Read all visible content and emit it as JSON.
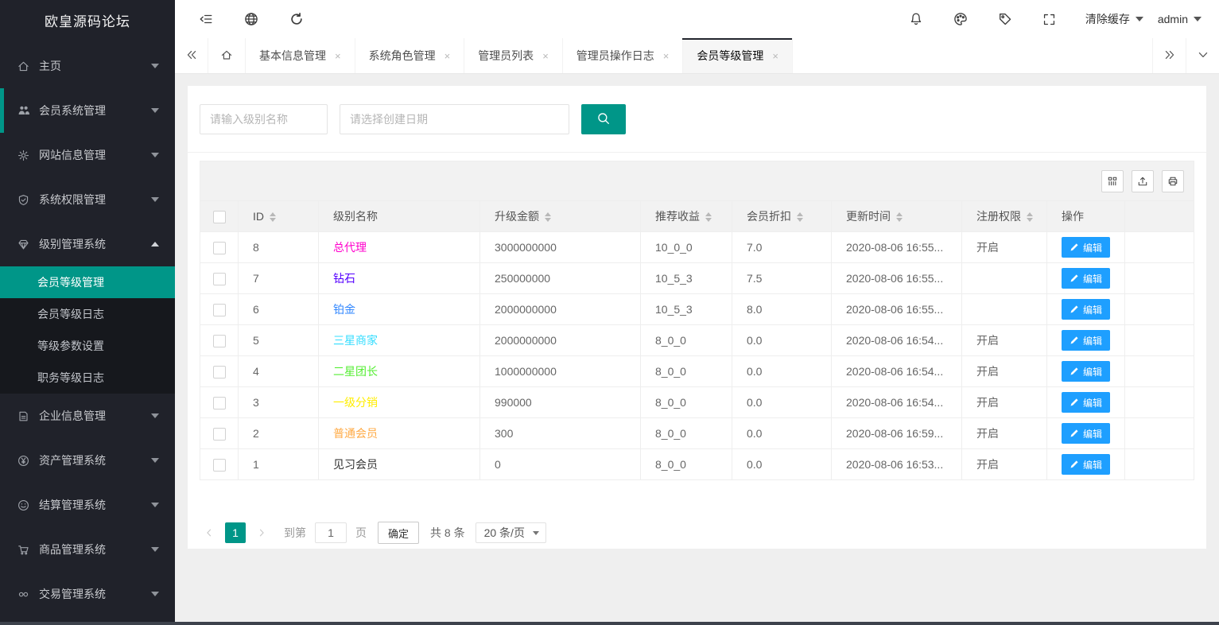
{
  "brand": "欧皇源码论坛",
  "colors": {
    "accent": "#009688",
    "primary_button": "#1e9fff",
    "sidebar_bg": "#20222a",
    "active_tab_bar": "#23262e"
  },
  "topbar": {
    "left_icons": [
      "collapse-menu-icon",
      "globe-icon",
      "refresh-icon"
    ],
    "right_icons": [
      "bell-icon",
      "palette-icon",
      "tag-icon",
      "fullscreen-icon"
    ],
    "clear_cache_label": "清除缓存",
    "username": "admin"
  },
  "sidebar": {
    "items": [
      {
        "label": "主页",
        "icon": "home-icon",
        "expanded": false
      },
      {
        "label": "会员系统管理",
        "icon": "users-icon",
        "expanded": false,
        "accent": true
      },
      {
        "label": "网站信息管理",
        "icon": "gear-icon",
        "expanded": false
      },
      {
        "label": "系统权限管理",
        "icon": "shield-icon",
        "expanded": false
      },
      {
        "label": "级别管理系统",
        "icon": "diamond-icon",
        "expanded": true,
        "children": [
          {
            "label": "会员等级管理",
            "active": true
          },
          {
            "label": "会员等级日志",
            "active": false
          },
          {
            "label": "等级参数设置",
            "active": false
          },
          {
            "label": "职务等级日志",
            "active": false
          }
        ]
      },
      {
        "label": "企业信息管理",
        "icon": "doc-icon",
        "expanded": false
      },
      {
        "label": "资产管理系统",
        "icon": "yen-icon",
        "expanded": false
      },
      {
        "label": "结算管理系统",
        "icon": "smiley-icon",
        "expanded": false
      },
      {
        "label": "商品管理系统",
        "icon": "cart-icon",
        "expanded": false
      },
      {
        "label": "交易管理系统",
        "icon": "infinity-icon",
        "expanded": false
      }
    ]
  },
  "tabbar": {
    "tabs": [
      {
        "label": "基本信息管理",
        "active": false
      },
      {
        "label": "系统角色管理",
        "active": false
      },
      {
        "label": "管理员列表",
        "active": false
      },
      {
        "label": "管理员操作日志",
        "active": false
      },
      {
        "label": "会员等级管理",
        "active": true
      }
    ]
  },
  "search": {
    "level_name_placeholder": "请输入级别名称",
    "create_date_placeholder": "请选择创建日期"
  },
  "toolbar_icons": [
    "columns-icon",
    "export-icon",
    "print-icon"
  ],
  "table": {
    "columns": [
      {
        "label": "ID",
        "sortable": true
      },
      {
        "label": "级别名称",
        "sortable": false
      },
      {
        "label": "升级金额",
        "sortable": true
      },
      {
        "label": "推荐收益",
        "sortable": true
      },
      {
        "label": "会员折扣",
        "sortable": true
      },
      {
        "label": "更新时间",
        "sortable": true
      },
      {
        "label": "注册权限",
        "sortable": true
      },
      {
        "label": "操作",
        "sortable": false
      }
    ],
    "edit_label": "编辑",
    "rows": [
      {
        "id": "8",
        "name": "总代理",
        "name_color": "#ff00cc",
        "amount": "3000000000",
        "referral": "10_0_0",
        "discount": "7.0",
        "updated": "2020-08-06 16:55...",
        "register": "开启"
      },
      {
        "id": "7",
        "name": "钻石",
        "name_color": "#5500ff",
        "amount": "250000000",
        "referral": "10_5_3",
        "discount": "7.5",
        "updated": "2020-08-06 16:55...",
        "register": ""
      },
      {
        "id": "6",
        "name": "铂金",
        "name_color": "#3388ff",
        "amount": "2000000000",
        "referral": "10_5_3",
        "discount": "8.0",
        "updated": "2020-08-06 16:55...",
        "register": ""
      },
      {
        "id": "5",
        "name": "三星商家",
        "name_color": "#33ddff",
        "amount": "2000000000",
        "referral": "8_0_0",
        "discount": "0.0",
        "updated": "2020-08-06 16:54...",
        "register": "开启"
      },
      {
        "id": "4",
        "name": "二星团长",
        "name_color": "#55ee33",
        "amount": "1000000000",
        "referral": "8_0_0",
        "discount": "0.0",
        "updated": "2020-08-06 16:54...",
        "register": "开启"
      },
      {
        "id": "3",
        "name": "一级分销",
        "name_color": "#ffee00",
        "amount": "990000",
        "referral": "8_0_0",
        "discount": "0.0",
        "updated": "2020-08-06 16:54...",
        "register": "开启"
      },
      {
        "id": "2",
        "name": "普通会员",
        "name_color": "#ffaa44",
        "amount": "300",
        "referral": "8_0_0",
        "discount": "0.0",
        "updated": "2020-08-06 16:59...",
        "register": "开启"
      },
      {
        "id": "1",
        "name": "见习会员",
        "name_color": "#333333",
        "amount": "0",
        "referral": "8_0_0",
        "discount": "0.0",
        "updated": "2020-08-06 16:53...",
        "register": "开启"
      }
    ]
  },
  "pagination": {
    "current_page": "1",
    "goto_label": "到第",
    "goto_value": "1",
    "page_unit_label": "页",
    "confirm_label": "确定",
    "total_label": "共 8 条",
    "page_size_label": "20 条/页"
  }
}
